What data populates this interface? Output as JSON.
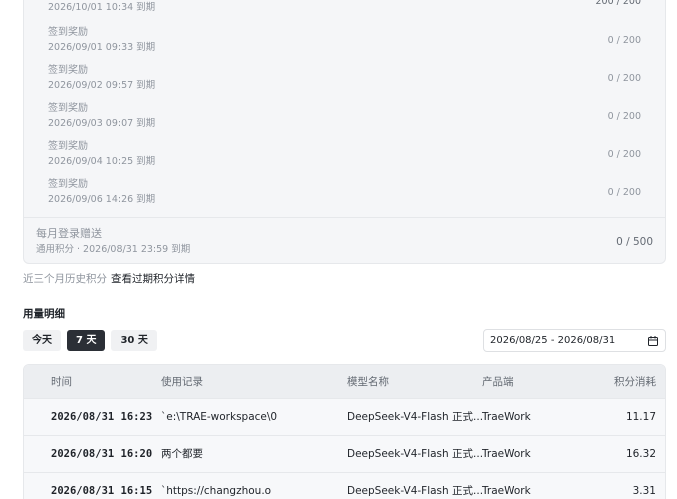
{
  "rewards": [
    {
      "title": "",
      "date": "2026/10/01 10:34 到期",
      "value": "200 / 200"
    },
    {
      "title": "签到奖励",
      "date": "2026/09/01 09:33 到期",
      "value": "0 / 200"
    },
    {
      "title": "签到奖励",
      "date": "2026/09/02 09:57 到期",
      "value": "0 / 200"
    },
    {
      "title": "签到奖励",
      "date": "2026/09/03 09:07 到期",
      "value": "0 / 200"
    },
    {
      "title": "签到奖励",
      "date": "2026/09/04 10:25 到期",
      "value": "0 / 200"
    },
    {
      "title": "签到奖励",
      "date": "2026/09/06 14:26 到期",
      "value": "0 / 200"
    }
  ],
  "monthly": {
    "title": "每月登录赠送",
    "subtitle": "通用积分 · 2026/08/31 23:59 到期",
    "value": "0 / 500"
  },
  "history": {
    "label": "近三个月历史积分",
    "link": "查看过期积分详情"
  },
  "usage": {
    "title": "用量明细",
    "ranges": [
      "今天",
      "7 天",
      "30 天"
    ],
    "active_range": "7 天",
    "date_range": "2026/08/25 - 2026/08/31",
    "columns": {
      "time": "时间",
      "record": "使用记录",
      "model": "模型名称",
      "product": "产品端",
      "points": "积分消耗"
    },
    "rows": [
      {
        "time": "2026/08/31 16:23",
        "record": "`e:\\TRAE-workspace\\0",
        "model": "DeepSeek-V4-Flash 正式...",
        "product": "TraeWork",
        "points": "11.17"
      },
      {
        "time": "2026/08/31 16:20",
        "record": "两个都要",
        "model": "DeepSeek-V4-Flash 正式...",
        "product": "TraeWork",
        "points": "16.32"
      },
      {
        "time": "2026/08/31 16:15",
        "record": "`https://changzhou.o",
        "model": "DeepSeek-V4-Flash 正式...",
        "product": "TraeWork",
        "points": "3.31"
      }
    ]
  }
}
